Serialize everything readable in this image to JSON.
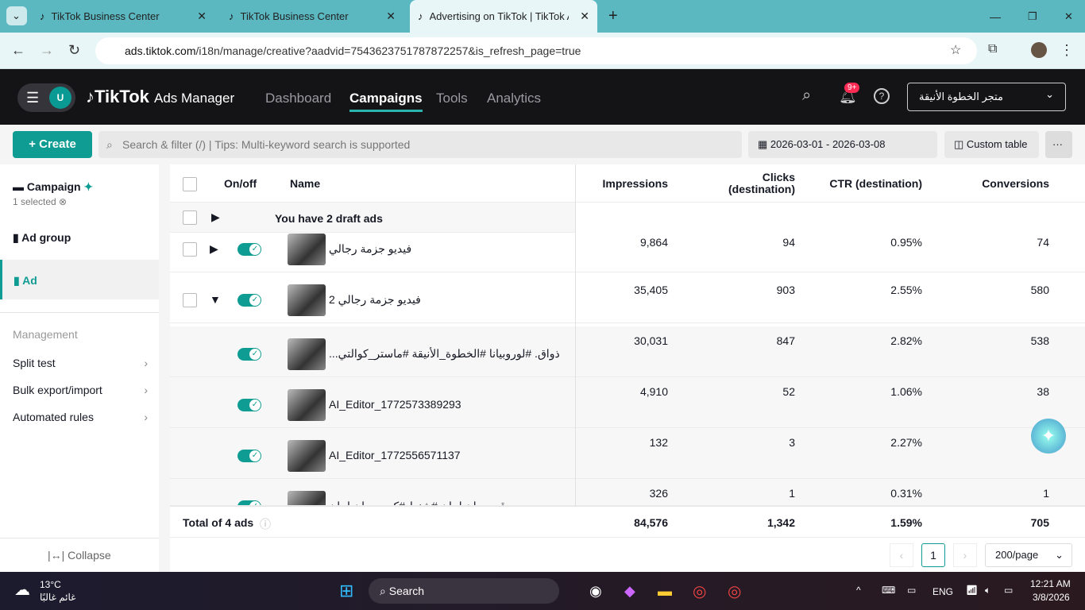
{
  "browser": {
    "tabs": [
      {
        "title": "TikTok Business Center"
      },
      {
        "title": "TikTok Business Center"
      },
      {
        "title": "Advertising on TikTok | TikTok A"
      }
    ],
    "url_domain": "ads.tiktok.com",
    "url_path": "/i18n/manage/creative?aadvid=7543623751787872257&is_refresh_page=true"
  },
  "header": {
    "avatar": "U",
    "logo": "TikTok",
    "logo_sub": "Ads Manager",
    "nav": [
      "Dashboard",
      "Campaigns",
      "Tools",
      "Analytics"
    ],
    "badge": "9+",
    "account": "متجر الخطوة الأنيقة"
  },
  "toolbar": {
    "create": "+ Create",
    "search_placeholder": "Search & filter (/) | Tips: Multi-keyword search is supported",
    "date_range": "2026-03-01 - 2026-03-08",
    "custom_table": "Custom table",
    "more": "···"
  },
  "sidebar": {
    "campaign": "Campaign",
    "selected": "1 selected",
    "ad_group": "Ad group",
    "ad": "Ad",
    "management": "Management",
    "items": [
      "Split test",
      "Bulk export/import",
      "Automated rules"
    ],
    "collapse": "Collapse"
  },
  "table": {
    "columns": {
      "onoff": "On/off",
      "name": "Name",
      "impressions": "Impressions",
      "clicks": "Clicks (destination)",
      "ctr": "CTR (destination)",
      "conversions": "Conversions"
    },
    "draft": "You have 2 draft ads",
    "rows": [
      {
        "name": "فيديو جزمة رجالي",
        "impressions": "9,864",
        "clicks": "94",
        "ctr": "0.95%",
        "conversions": "74"
      },
      {
        "name": "فيديو جزمة رجالي 2",
        "impressions": "35,405",
        "clicks": "903",
        "ctr": "2.55%",
        "conversions": "580"
      },
      {
        "name": "...ذواق. #لوروبيانا #الخطوة_الأنيقة #ماستر_كوالتي",
        "impressions": "30,031",
        "clicks": "847",
        "ctr": "2.82%",
        "conversions": "538"
      },
      {
        "name": "AI_Editor_1772573389293",
        "impressions": "4,910",
        "clicks": "52",
        "ctr": "1.06%",
        "conversions": "38"
      },
      {
        "name": "AI_Editor_1772556571137",
        "impressions": "132",
        "clicks": "3",
        "ctr": "2.27%",
        "conversions": ""
      },
      {
        "name": "قم بسان لمان #شنط #كعب سان لمان",
        "impressions": "326",
        "clicks": "1",
        "ctr": "0.31%",
        "conversions": "1"
      }
    ],
    "total": {
      "label": "Total of 4 ads",
      "impressions": "84,576",
      "clicks": "1,342",
      "ctr": "1.59%",
      "conversions": "705"
    }
  },
  "pagination": {
    "page": "1",
    "per_page": "200/page"
  },
  "taskbar": {
    "temp": "13°C",
    "weather": "غائم غالبًا",
    "search": "Search",
    "lang": "ENG",
    "time": "12:21 AM",
    "date": "3/8/2026"
  }
}
